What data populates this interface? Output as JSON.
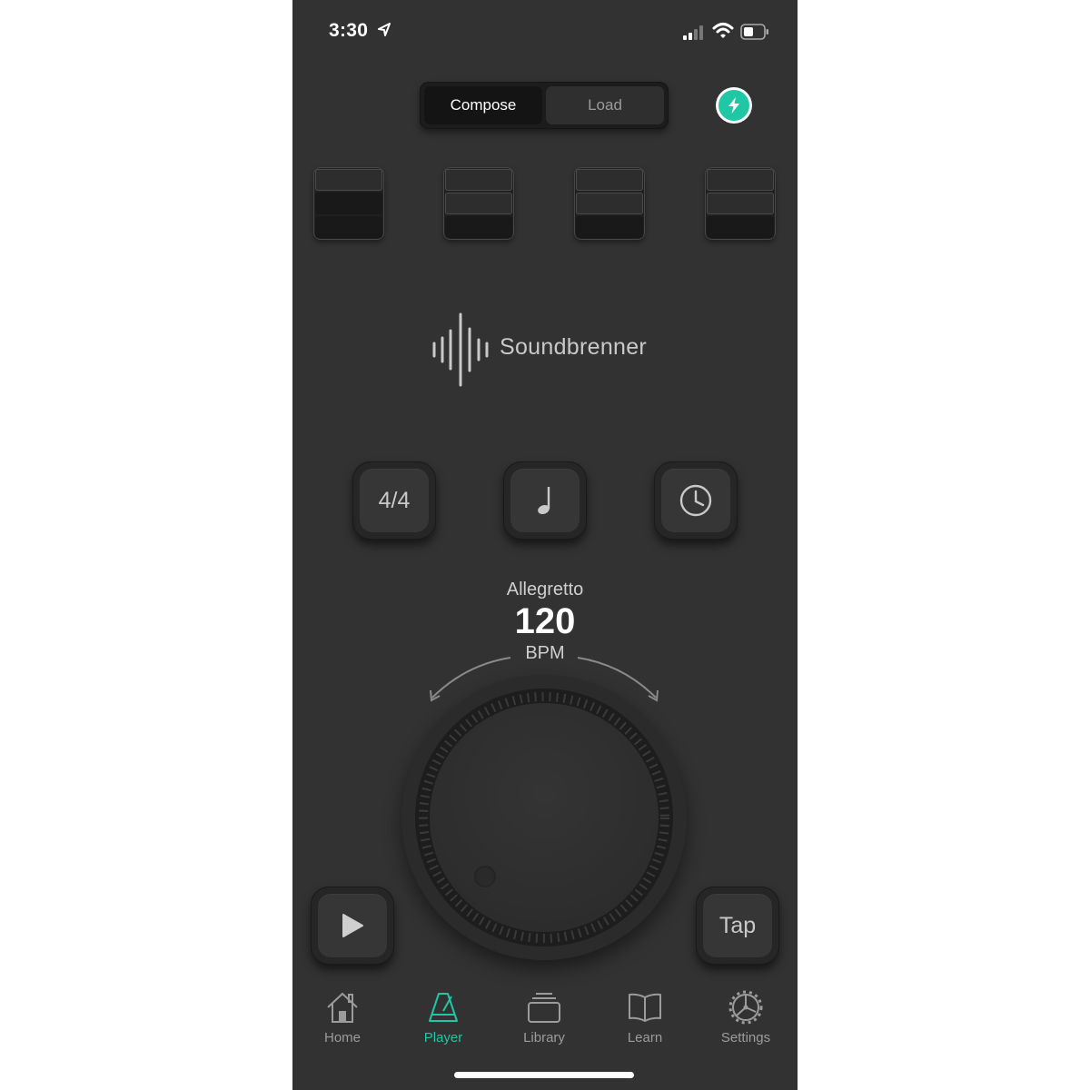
{
  "status_bar": {
    "time": "3:30",
    "icons": [
      "location-arrow-icon",
      "cellular-signal-icon",
      "wifi-icon",
      "battery-icon"
    ]
  },
  "mode_toggle": {
    "options": [
      {
        "label": "Compose",
        "selected": true
      },
      {
        "label": "Load",
        "selected": false
      }
    ]
  },
  "bolt_button": {
    "icon": "lightning-bolt-icon",
    "color": "#1fc7a5"
  },
  "beat_blocks": [
    {
      "levels": [
        "empty",
        "filled",
        "filled"
      ]
    },
    {
      "levels": [
        "empty",
        "empty",
        "filled"
      ]
    },
    {
      "levels": [
        "empty",
        "empty",
        "filled"
      ]
    },
    {
      "levels": [
        "empty",
        "empty",
        "filled"
      ]
    }
  ],
  "logo": {
    "text": "Soundbrenner",
    "icon": "soundwave-logo-icon"
  },
  "controls": {
    "time_signature": "4/4",
    "subdivision_icon": "quarter-note-icon",
    "timer_icon": "clock-icon"
  },
  "tempo": {
    "name": "Allegretto",
    "value": "120",
    "unit": "BPM"
  },
  "play_button": {
    "icon": "play-icon"
  },
  "tap_button": {
    "label": "Tap"
  },
  "tab_bar": {
    "tabs": [
      {
        "label": "Home",
        "icon": "home-icon",
        "active": false
      },
      {
        "label": "Player",
        "icon": "metronome-icon",
        "active": true
      },
      {
        "label": "Library",
        "icon": "library-icon",
        "active": false
      },
      {
        "label": "Learn",
        "icon": "book-icon",
        "active": false
      },
      {
        "label": "Settings",
        "icon": "gear-icon",
        "active": false
      }
    ]
  },
  "colors": {
    "background": "#323232",
    "accent": "#1fc7a5",
    "text_primary": "#ffffff",
    "text_secondary": "#9c9c9c"
  }
}
